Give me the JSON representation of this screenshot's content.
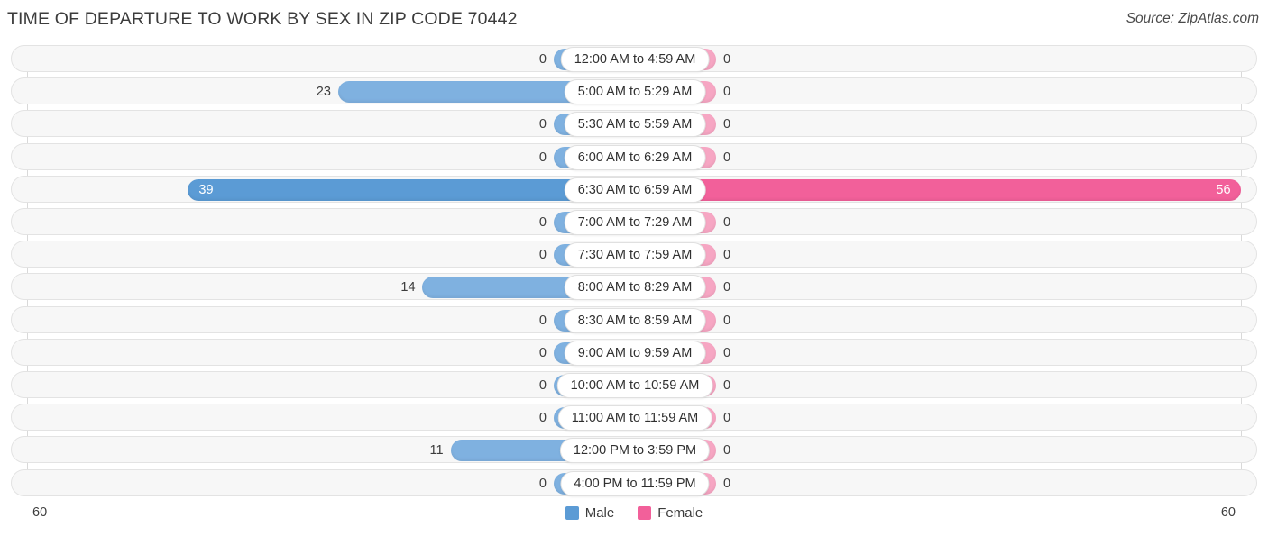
{
  "header": {
    "title": "TIME OF DEPARTURE TO WORK BY SEX IN ZIP CODE 70442",
    "source": "Source: ZipAtlas.com"
  },
  "axis": {
    "left_min_label": "60",
    "right_min_label": "60",
    "max": 60
  },
  "legend": {
    "items": [
      {
        "label": "Male",
        "color": "#5b9bd5"
      },
      {
        "label": "Female",
        "color": "#f2609a"
      }
    ]
  },
  "colors": {
    "male": "#7fb1e0",
    "male_highlight": "#5b9bd5",
    "female": "#f6a6c3",
    "female_highlight": "#f2609a",
    "row_background": "#f7f7f7",
    "row_border": "#e3e3e3",
    "gridline": "#d9d9d9",
    "text": "#3c3c3c"
  },
  "chart_data": {
    "type": "bar",
    "title": "TIME OF DEPARTURE TO WORK BY SEX IN ZIP CODE 70442",
    "subtitle": "",
    "xlabel": "",
    "ylabel": "",
    "orientation": "horizontal",
    "layout": "diverging-bidirectional",
    "grid": false,
    "legend_position": "bottom-center",
    "xlim": [
      60,
      60
    ],
    "categories": [
      "12:00 AM to 4:59 AM",
      "5:00 AM to 5:29 AM",
      "5:30 AM to 5:59 AM",
      "6:00 AM to 6:29 AM",
      "6:30 AM to 6:59 AM",
      "7:00 AM to 7:29 AM",
      "7:30 AM to 7:59 AM",
      "8:00 AM to 8:29 AM",
      "8:30 AM to 8:59 AM",
      "9:00 AM to 9:59 AM",
      "10:00 AM to 10:59 AM",
      "11:00 AM to 11:59 AM",
      "12:00 PM to 3:59 PM",
      "4:00 PM to 11:59 PM"
    ],
    "series": [
      {
        "name": "Male",
        "side": "left",
        "color": "#5b9bd5",
        "values": [
          0,
          23,
          0,
          0,
          39,
          0,
          0,
          14,
          0,
          0,
          0,
          0,
          11,
          0
        ],
        "labels": [
          "0",
          "23",
          "0",
          "0",
          "39",
          "0",
          "0",
          "14",
          "0",
          "0",
          "0",
          "0",
          "11",
          "0"
        ]
      },
      {
        "name": "Female",
        "side": "right",
        "color": "#f2609a",
        "values": [
          0,
          0,
          0,
          0,
          56,
          0,
          0,
          0,
          0,
          0,
          0,
          0,
          0,
          0
        ],
        "labels": [
          "0",
          "0",
          "0",
          "0",
          "56",
          "0",
          "0",
          "0",
          "0",
          "0",
          "0",
          "0",
          "0",
          "0"
        ]
      }
    ],
    "highlighted_category": "6:30 AM to 6:59 AM"
  }
}
